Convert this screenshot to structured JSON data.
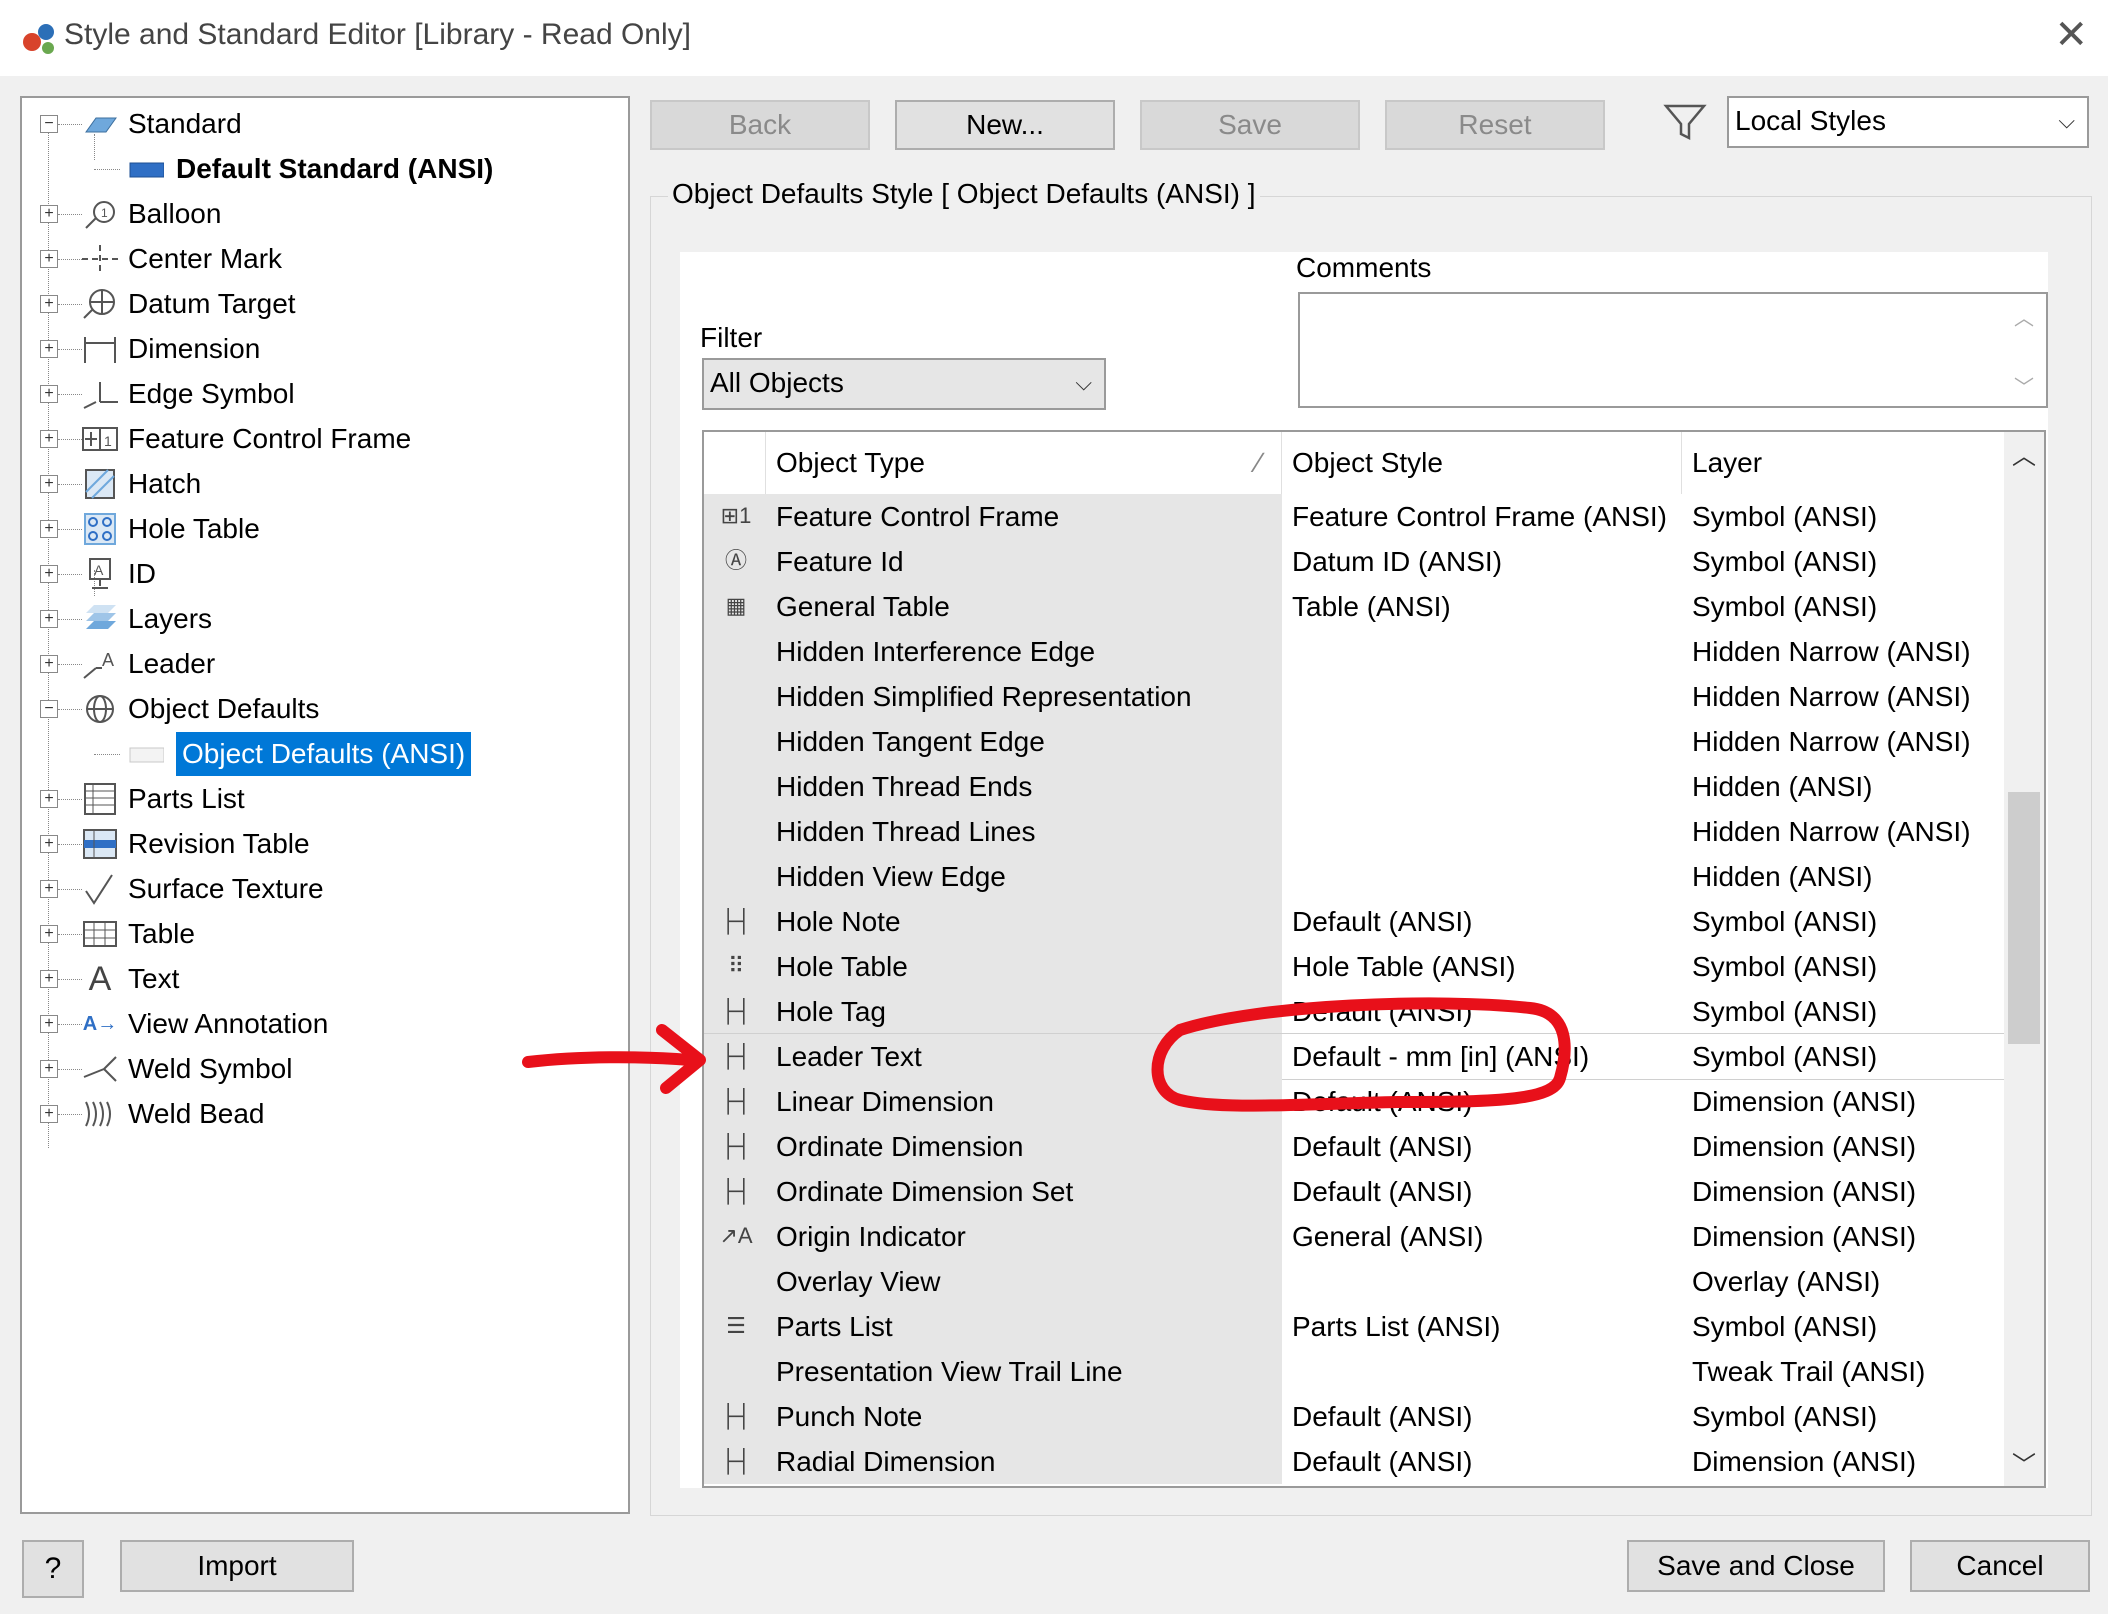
{
  "window": {
    "title": "Style and Standard Editor [Library - Read Only]"
  },
  "tree": {
    "items": [
      {
        "label": "Standard",
        "icon": "standard-icon"
      },
      {
        "label": "Default Standard (ANSI)",
        "icon": "standard-child-icon"
      },
      {
        "label": "Balloon",
        "icon": "balloon-icon"
      },
      {
        "label": "Center Mark",
        "icon": "center-mark-icon"
      },
      {
        "label": "Datum Target",
        "icon": "datum-target-icon"
      },
      {
        "label": "Dimension",
        "icon": "dimension-icon"
      },
      {
        "label": "Edge Symbol",
        "icon": "edge-symbol-icon"
      },
      {
        "label": "Feature Control Frame",
        "icon": "feature-control-frame-icon"
      },
      {
        "label": "Hatch",
        "icon": "hatch-icon"
      },
      {
        "label": "Hole Table",
        "icon": "hole-table-icon"
      },
      {
        "label": "ID",
        "icon": "id-icon"
      },
      {
        "label": "Layers",
        "icon": "layers-icon"
      },
      {
        "label": "Leader",
        "icon": "leader-icon"
      },
      {
        "label": "Object Defaults",
        "icon": "object-defaults-icon"
      },
      {
        "label": "Object Defaults (ANSI)",
        "icon": "object-defaults-child-icon"
      },
      {
        "label": "Parts List",
        "icon": "parts-list-icon"
      },
      {
        "label": "Revision Table",
        "icon": "revision-table-icon"
      },
      {
        "label": "Surface Texture",
        "icon": "surface-texture-icon"
      },
      {
        "label": "Table",
        "icon": "table-icon"
      },
      {
        "label": "Text",
        "icon": "text-icon"
      },
      {
        "label": "View Annotation",
        "icon": "view-annotation-icon"
      },
      {
        "label": "Weld Symbol",
        "icon": "weld-symbol-icon"
      },
      {
        "label": "Weld Bead",
        "icon": "weld-bead-icon"
      }
    ]
  },
  "toolbar": {
    "back": "Back",
    "new": "New...",
    "save": "Save",
    "reset": "Reset",
    "styles_filter": "Local Styles"
  },
  "style": {
    "group_title": "Object Defaults Style [ Object Defaults (ANSI) ]",
    "filter_label": "Filter",
    "filter_value": "All Objects",
    "comments_label": "Comments",
    "comments_value": ""
  },
  "grid": {
    "headers": [
      "Object Type",
      "Object Style",
      "Layer"
    ],
    "rows": [
      {
        "type": "Feature Control Frame",
        "style": "Feature Control Frame (ANSI)",
        "layer": "Symbol (ANSI)",
        "icon": "feature-control-frame-icon"
      },
      {
        "type": "Feature Id",
        "style": "Datum ID (ANSI)",
        "layer": "Symbol (ANSI)",
        "icon": "feature-id-icon"
      },
      {
        "type": "General Table",
        "style": "Table (ANSI)",
        "layer": "Symbol (ANSI)",
        "icon": "table-icon"
      },
      {
        "type": "Hidden Interference Edge",
        "style": "",
        "layer": "Hidden Narrow (ANSI)",
        "icon": ""
      },
      {
        "type": "Hidden Simplified Representation",
        "style": "",
        "layer": "Hidden Narrow (ANSI)",
        "icon": ""
      },
      {
        "type": "Hidden Tangent Edge",
        "style": "",
        "layer": "Hidden Narrow (ANSI)",
        "icon": ""
      },
      {
        "type": "Hidden Thread Ends",
        "style": "",
        "layer": "Hidden (ANSI)",
        "icon": ""
      },
      {
        "type": "Hidden Thread Lines",
        "style": "",
        "layer": "Hidden Narrow (ANSI)",
        "icon": ""
      },
      {
        "type": "Hidden View Edge",
        "style": "",
        "layer": "Hidden (ANSI)",
        "icon": ""
      },
      {
        "type": "Hole Note",
        "style": "Default (ANSI)",
        "layer": "Symbol (ANSI)",
        "icon": "dimension-icon"
      },
      {
        "type": "Hole Table",
        "style": "Hole Table (ANSI)",
        "layer": "Symbol (ANSI)",
        "icon": "hole-table-icon"
      },
      {
        "type": "Hole Tag",
        "style": "Default (ANSI)",
        "layer": "Symbol (ANSI)",
        "icon": "dimension-icon"
      },
      {
        "type": "Leader Text",
        "style": "Default - mm [in] (ANSI)",
        "layer": "Symbol (ANSI)",
        "icon": "dimension-icon"
      },
      {
        "type": "Linear Dimension",
        "style": "Default (ANSI)",
        "layer": "Dimension (ANSI)",
        "icon": "dimension-icon"
      },
      {
        "type": "Ordinate Dimension",
        "style": "Default (ANSI)",
        "layer": "Dimension (ANSI)",
        "icon": "dimension-icon"
      },
      {
        "type": "Ordinate Dimension Set",
        "style": "Default (ANSI)",
        "layer": "Dimension (ANSI)",
        "icon": "dimension-icon"
      },
      {
        "type": "Origin Indicator",
        "style": "General (ANSI)",
        "layer": "Dimension (ANSI)",
        "icon": "leader-icon"
      },
      {
        "type": "Overlay View",
        "style": "",
        "layer": "Overlay (ANSI)",
        "icon": ""
      },
      {
        "type": "Parts List",
        "style": "Parts List (ANSI)",
        "layer": "Symbol (ANSI)",
        "icon": "parts-list-icon"
      },
      {
        "type": "Presentation View Trail Line",
        "style": "",
        "layer": "Tweak Trail (ANSI)",
        "icon": ""
      },
      {
        "type": "Punch Note",
        "style": "Default (ANSI)",
        "layer": "Symbol (ANSI)",
        "icon": "dimension-icon"
      },
      {
        "type": "Radial Dimension",
        "style": "Default (ANSI)",
        "layer": "Dimension (ANSI)",
        "icon": "dimension-icon"
      }
    ]
  },
  "footer": {
    "help": "?",
    "import": "Import",
    "save_close": "Save and Close",
    "cancel": "Cancel"
  },
  "colors": {
    "selection": "#0078d7",
    "annotation": "#e8101a"
  }
}
